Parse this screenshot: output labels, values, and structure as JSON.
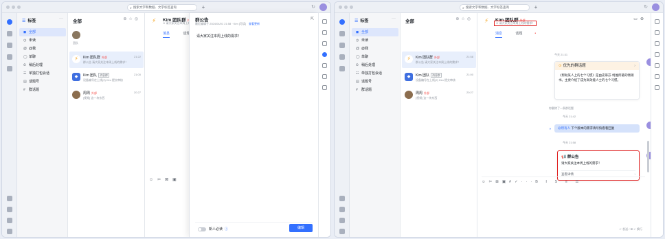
{
  "browser": {
    "search_placeholder": "搜索文字和数据、文字标签查询",
    "new_tab": "+"
  },
  "left": {
    "nav": {
      "title": "标签",
      "more": "···",
      "items": [
        {
          "icon": "chat-icon",
          "glyph": "◼",
          "label": "全部"
        },
        {
          "icon": "unread-icon",
          "glyph": "◷",
          "label": "未读"
        },
        {
          "icon": "at-icon",
          "glyph": "@",
          "label": "@我"
        },
        {
          "icon": "single-chat-icon",
          "glyph": "◯",
          "label": "单聊"
        },
        {
          "icon": "later-icon",
          "glyph": "⏲",
          "label": "稍后处理"
        },
        {
          "icon": "group-icon",
          "glyph": "☷",
          "label": "单独打包会话"
        },
        {
          "icon": "doc-icon",
          "glyph": "▤",
          "label": "话题号"
        },
        {
          "icon": "topic-icon",
          "glyph": "#",
          "label": "群话题"
        }
      ]
    },
    "list": {
      "title": "全部",
      "me_label": "团队",
      "chats": [
        {
          "name": "Kim 团队群",
          "tag": "外部",
          "preview": "群公告 请大家关注本周上线的需求！",
          "time": "21:22"
        },
        {
          "name": "Kim 团队",
          "tag": "消息群",
          "preview": "设备编号在上线(2) Kim 提交审核",
          "time": "21:00"
        },
        {
          "name": "周周",
          "tag": "外部",
          "preview": "[视频] 这一块东西",
          "time": "20:27"
        }
      ]
    },
    "conversation": {
      "name": "Kim 团队群",
      "tag": "外部",
      "sub": "⊙ 请大家关注本周上线的需求！",
      "tabs": [
        "消息",
        "话题"
      ]
    },
    "announcement_panel": {
      "title": "群公告",
      "meta": "最近编辑于 2024/04/01 21:58 · Kim [可读]",
      "link": "查看更新",
      "body": "请大家关注本周上线的需求！",
      "toggle_label": "新人必读",
      "edit_button": "编辑"
    }
  },
  "right": {
    "nav": {
      "title": "标签",
      "items": [
        "全部",
        "未读",
        "@我",
        "单聊",
        "稍后处理",
        "单独打包会话",
        "话题号",
        "群话题"
      ]
    },
    "list": {
      "title": "全部",
      "chats": [
        {
          "name": "Kim 团队群",
          "tag": "外部",
          "preview": "群公告 请大家关注本周上线的需求！",
          "time": "21:58"
        },
        {
          "name": "Kim 团队",
          "tag": "消息群",
          "preview": "设备编号在上线(2) Kim 提交审核",
          "time": "21:00"
        },
        {
          "name": "周周",
          "tag": "外部",
          "preview": "[视频] 这一块东西",
          "time": "20:27"
        }
      ]
    },
    "conversation": {
      "name": "Kim 团队群",
      "tag": "外部",
      "sub": "⊙ 请大家关注本周上线的需求！",
      "tabs": [
        "消息",
        "话题"
      ],
      "messages": {
        "ts1": "今天 21:31",
        "topic_card_title": "优先的群话题",
        "topic_card_body": "《帮助某人上的七个习惯》是由史蒂芬·柯维所著的畅销书。主要介绍了成为高效能人士的七个习惯。",
        "sys_msg": "你删除了一条群话题",
        "ts2": "今天 21:42",
        "bubble_at": "@所有人",
        "bubble_text": " 下个版本的需求请尽快看看回复",
        "ts3": "今天 21:58",
        "ann_title": "群公告",
        "ann_body": "请大家关注本周上线的需求！",
        "ann_footer": "查看详情"
      },
      "send_hint": "↵ 发送 / ⌘ ↵ 换行"
    }
  }
}
